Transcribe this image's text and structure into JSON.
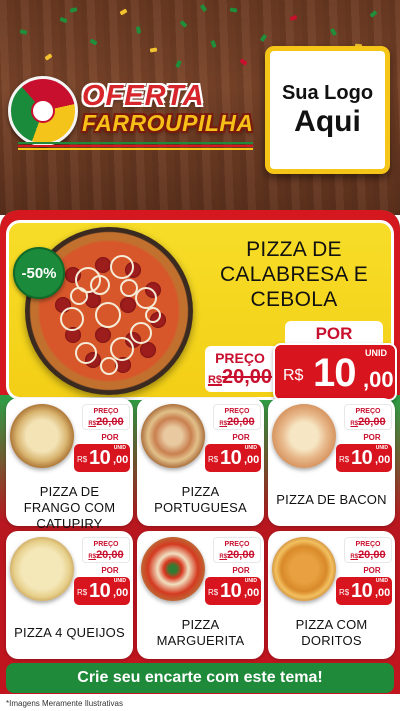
{
  "header": {
    "brand_line1": "OFERTA",
    "brand_line2": "FARROUPILHA",
    "logo_line1": "Sua Logo",
    "logo_line2": "Aqui"
  },
  "featured": {
    "discount": "-50%",
    "title": "PIZZA DE CALABRESA E CEBOLA",
    "preco_label": "PREÇO",
    "old_currency": "R$",
    "old_price": "20,00",
    "por_label": "POR",
    "unid_label": "UNID",
    "new_currency": "R$",
    "new_price_int": "10",
    "new_price_cents": ",00"
  },
  "products": [
    {
      "name": "PIZZA DE FRANGO COM CATUPIRY",
      "preco_label": "PREÇO",
      "old_currency": "R$",
      "old_price": "20,00",
      "por_label": "POR",
      "unid_label": "UNID",
      "new_currency": "R$",
      "new_price_int": "10",
      "new_price_cents": ",00",
      "image_icon": "pizza-frango-icon"
    },
    {
      "name": "PIZZA PORTUGUESA",
      "preco_label": "PREÇO",
      "old_currency": "R$",
      "old_price": "20,00",
      "por_label": "POR",
      "unid_label": "UNID",
      "new_currency": "R$",
      "new_price_int": "10",
      "new_price_cents": ",00",
      "image_icon": "pizza-portuguesa-icon"
    },
    {
      "name": "PIZZA DE BACON",
      "preco_label": "PREÇO",
      "old_currency": "R$",
      "old_price": "20,00",
      "por_label": "POR",
      "unid_label": "UNID",
      "new_currency": "R$",
      "new_price_int": "10",
      "new_price_cents": ",00",
      "image_icon": "pizza-bacon-icon"
    },
    {
      "name": "PIZZA 4 QUEIJOS",
      "preco_label": "PREÇO",
      "old_currency": "R$",
      "old_price": "20,00",
      "por_label": "POR",
      "unid_label": "UNID",
      "new_currency": "R$",
      "new_price_int": "10",
      "new_price_cents": ",00",
      "image_icon": "pizza-4-queijos-icon"
    },
    {
      "name": "PIZZA MARGUERITA",
      "preco_label": "PREÇO",
      "old_currency": "R$",
      "old_price": "20,00",
      "por_label": "POR",
      "unid_label": "UNID",
      "new_currency": "R$",
      "new_price_int": "10",
      "new_price_cents": ",00",
      "image_icon": "pizza-marguerita-icon"
    },
    {
      "name": "PIZZA COM DORITOS",
      "preco_label": "PREÇO",
      "old_currency": "R$",
      "old_price": "20,00",
      "por_label": "POR",
      "unid_label": "UNID",
      "new_currency": "R$",
      "new_price_int": "10",
      "new_price_cents": ",00",
      "image_icon": "pizza-doritos-icon"
    }
  ],
  "cta": "Crie seu encarte com este tema!",
  "disclaimer": "*Imagens Meramente Ilustrativas",
  "colors": {
    "green": "#1f8a3a",
    "red": "#d5171f",
    "yellow": "#f5c518",
    "wood": "#6b3a22"
  }
}
